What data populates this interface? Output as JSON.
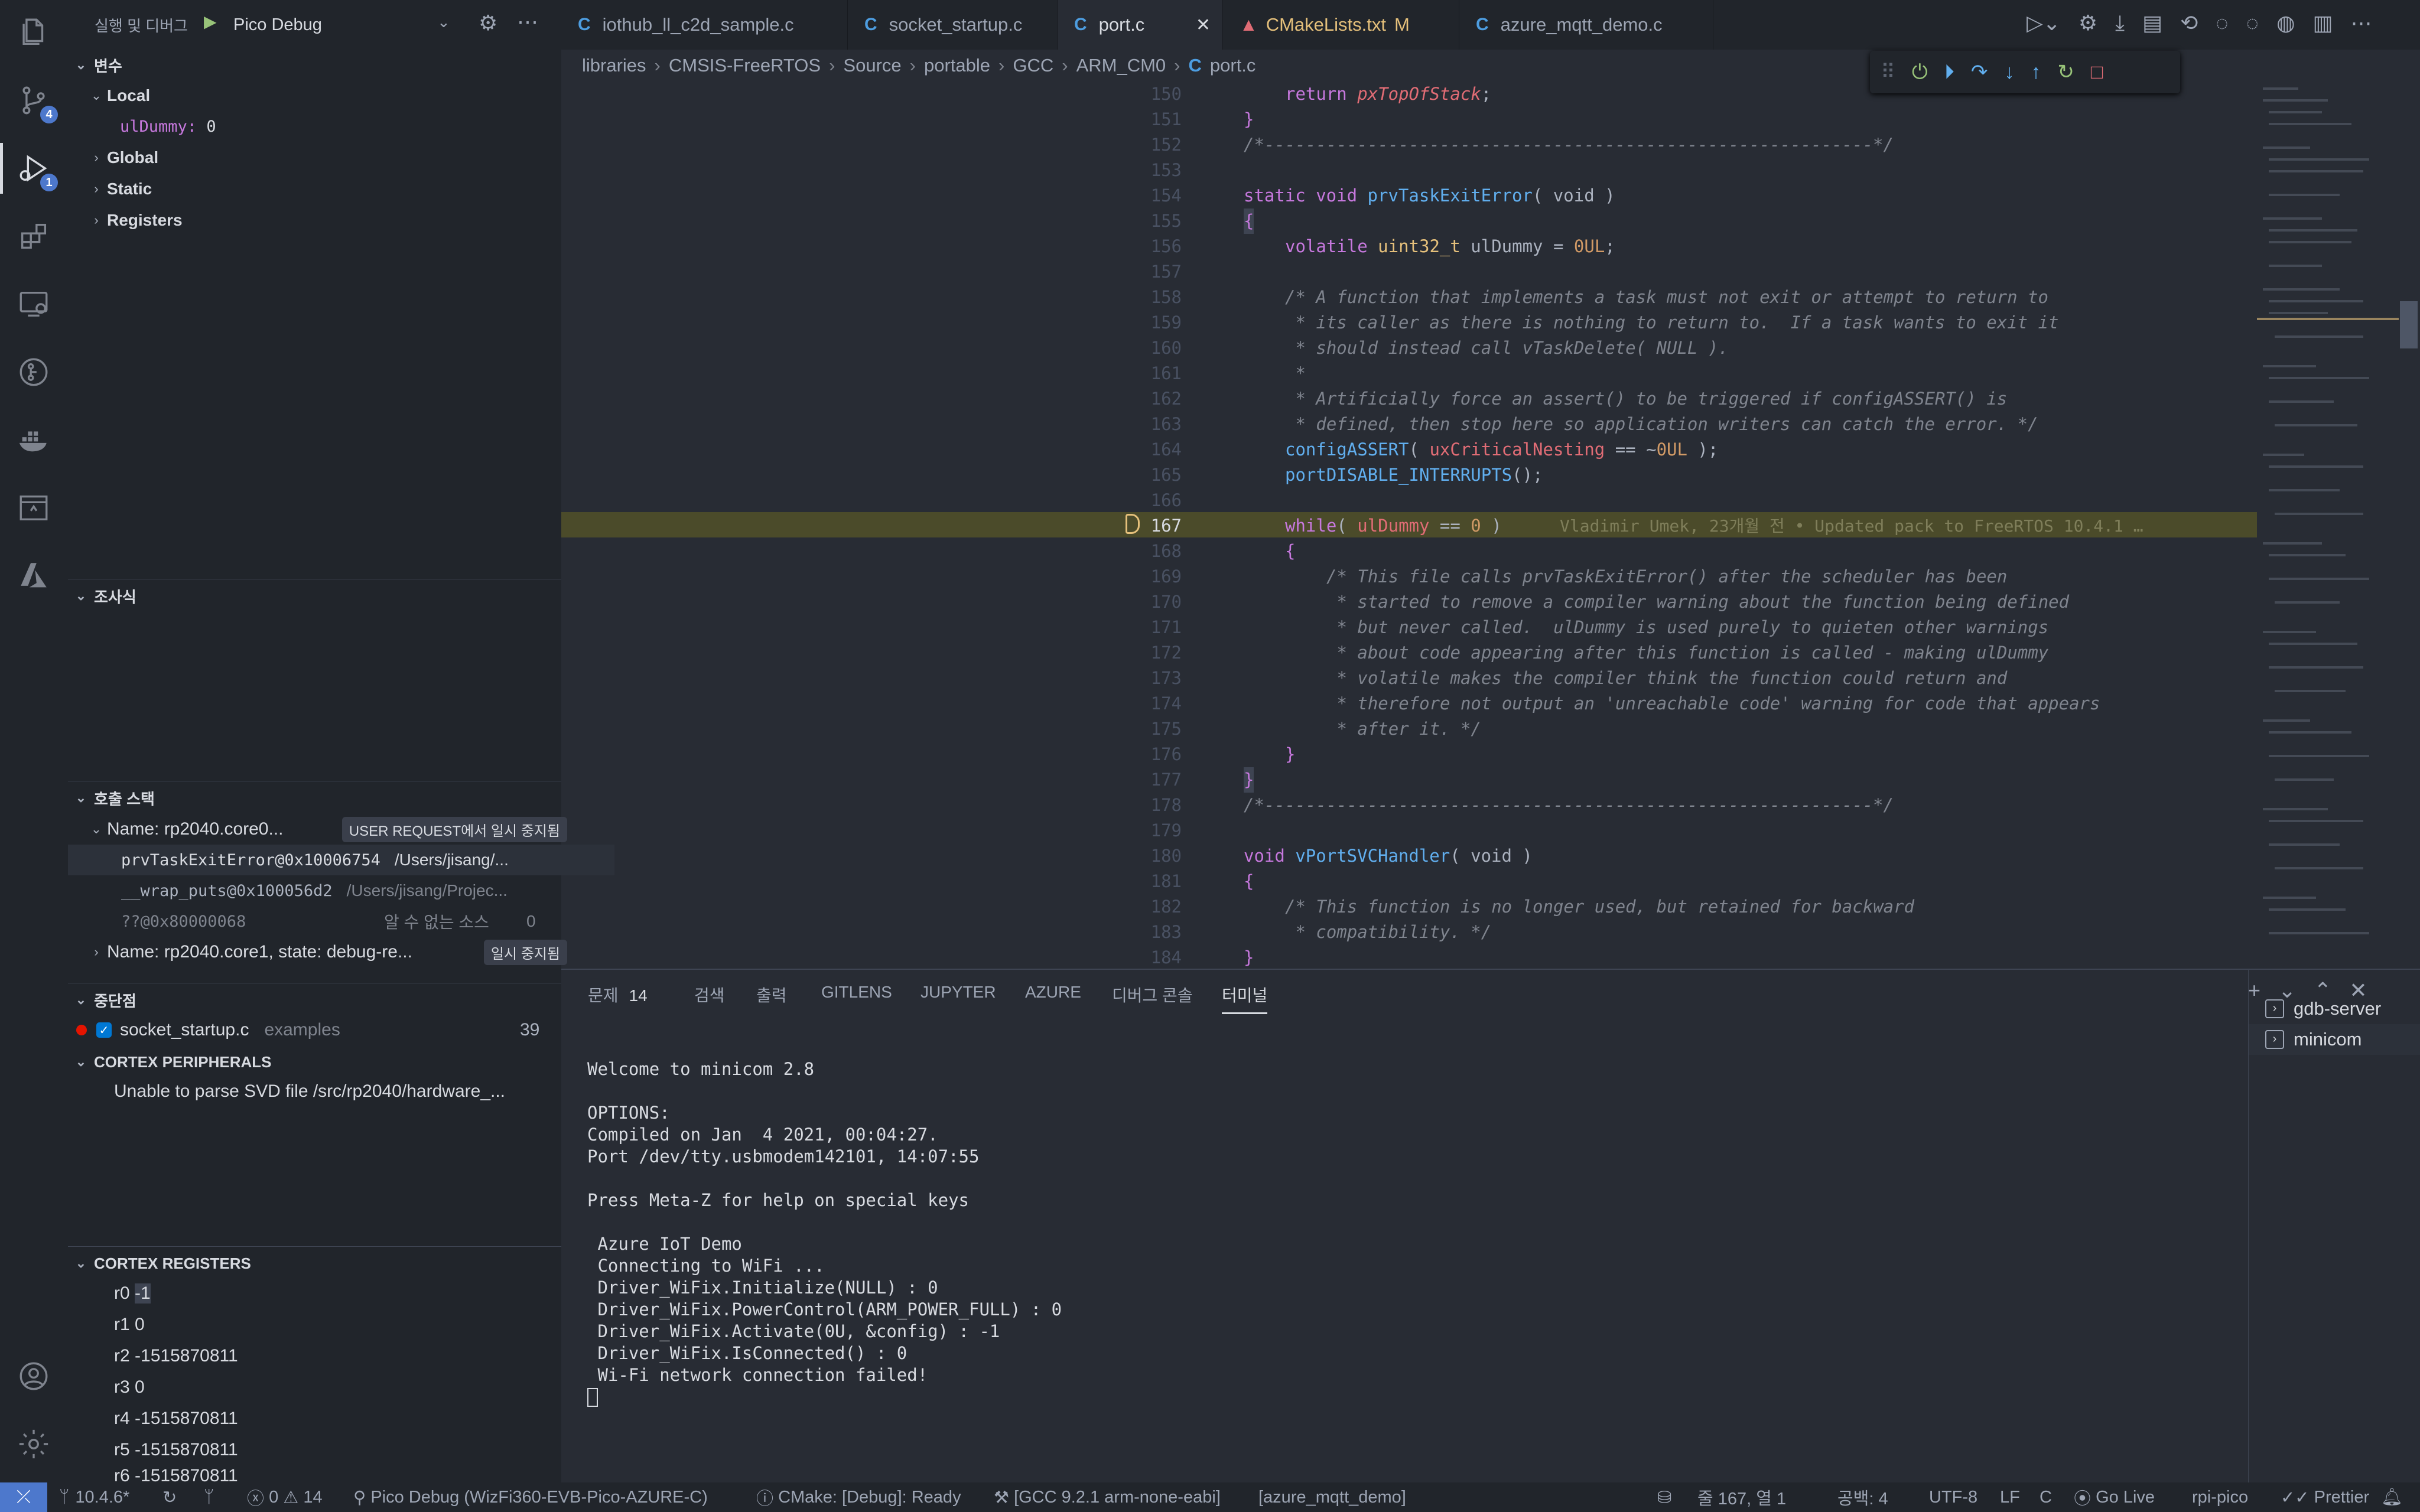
{
  "sidebar": {
    "debug_title": "실행 및 디버그",
    "config": "Pico Debug",
    "variables_header": "변수",
    "variables": {
      "local": "Local",
      "local_var_name": "ulDummy",
      "local_var_value": "0",
      "global": "Global",
      "static": "Static",
      "registers": "Registers"
    },
    "watch_header": "조사식",
    "callstack_header": "호출 스택",
    "callstack": {
      "thread0": "Name: rp2040.core0...",
      "thread0_state": "USER REQUEST에서 일시 중지됨",
      "frame0_fn": "prvTaskExitError@0x10006754",
      "frame0_path": "/Users/jisang/...",
      "frame1_fn": "__wrap_puts@0x100056d2",
      "frame1_path": "/Users/jisang/Projec...",
      "frame2_fn": "??@0x80000068",
      "frame2_src": "알 수 없는 소스",
      "frame2_line": "0",
      "thread1": "Name: rp2040.core1, state: debug-re...",
      "thread1_state": "일시 중지됨"
    },
    "breakpoints_header": "중단점",
    "breakpoint": {
      "file": "socket_startup.c",
      "folder": "examples",
      "line": "39"
    },
    "peripherals_header": "CORTEX PERIPHERALS",
    "peripherals_msg": "Unable to parse SVD file /src/rp2040/hardware_...",
    "registers_header": "CORTEX REGISTERS",
    "registers": [
      {
        "name": "r0",
        "value": "-1"
      },
      {
        "name": "r1",
        "value": "0"
      },
      {
        "name": "r2",
        "value": "-1515870811"
      },
      {
        "name": "r3",
        "value": "0"
      },
      {
        "name": "r4",
        "value": "-1515870811"
      },
      {
        "name": "r5",
        "value": "-1515870811"
      },
      {
        "name": "r6",
        "value": "-1515870811"
      }
    ]
  },
  "activity": {
    "scm_badge": "4",
    "debug_badge": "1"
  },
  "tabs": [
    {
      "label": "iothub_ll_c2d_sample.c",
      "icon": "C"
    },
    {
      "label": "socket_startup.c",
      "icon": "C"
    },
    {
      "label": "port.c",
      "icon": "C"
    },
    {
      "label": "CMakeLists.txt",
      "icon": "cmake",
      "modified": "M"
    },
    {
      "label": "azure_mqtt_demo.c",
      "icon": "C"
    }
  ],
  "breadcrumb": [
    "libraries",
    "CMSIS-FreeRTOS",
    "Source",
    "portable",
    "GCC",
    "ARM_CM0",
    "port.c"
  ],
  "editor": {
    "blame": "Vladimir Umek, 23개월 전 • Updated pack to FreeRTOS 10.4.1 …",
    "current_line": "167",
    "line_numbers": [
      "150",
      "151",
      "152",
      "153",
      "154",
      "155",
      "156",
      "157",
      "158",
      "159",
      "160",
      "161",
      "162",
      "163",
      "164",
      "165",
      "166",
      "167",
      "168",
      "169",
      "170",
      "171",
      "172",
      "173",
      "174",
      "175",
      "176",
      "177",
      "178",
      "179",
      "180",
      "181",
      "182",
      "183",
      "184"
    ],
    "code": {
      "150_kw": "return",
      "150_v": "pxTopOfStack",
      "151": "}",
      "152": "/*-----------------------------------------------------------*/",
      "154_kw": "static void",
      "154_fn": "prvTaskExitError",
      "154_rest": "( void )",
      "155": "{",
      "156_kw": "volatile",
      "156_ty": "uint32_t",
      "156_rest": " ulDummy = ",
      "156_num": "0UL",
      "156_end": ";",
      "158": "/* A function that implements a task must not exit or attempt to return to",
      "159": " * its caller as there is nothing to return to.  If a task wants to exit it",
      "160": " * should instead call vTaskDelete( NULL ).",
      "161": " *",
      "162": " * Artificially force an assert() to be triggered if configASSERT() is",
      "163": " * defined, then stop here so application writers can catch the error. */",
      "164_fn": "configASSERT",
      "164_a": "( ",
      "164_v": "uxCriticalNesting",
      "164_b": " == ~",
      "164_num": "0UL",
      "164_c": " );",
      "165_fn": "portDISABLE_INTERRUPTS",
      "165_rest": "();",
      "167_kw": "while",
      "167_a": "( ",
      "167_v": "ulDummy",
      "167_b": " == ",
      "167_num": "0",
      "167_c": " )",
      "168": "{",
      "169": "/* This file calls prvTaskExitError() after the scheduler has been",
      "170": " * started to remove a compiler warning about the function being defined",
      "171": " * but never called.  ulDummy is used purely to quieten other warnings",
      "172": " * about code appearing after this function is called - making ulDummy",
      "173": " * volatile makes the compiler think the function could return and",
      "174": " * therefore not output an 'unreachable code' warning for code that appears",
      "175": " * after it. */",
      "176": "}",
      "177": "}",
      "178": "/*-----------------------------------------------------------*/",
      "180_kw": "void",
      "180_fn": "vPortSVCHandler",
      "180_rest": "( void )",
      "181": "{",
      "182": "/* This function is no longer used, but retained for backward",
      "183": " * compatibility. */",
      "184": "}"
    }
  },
  "panel": {
    "tabs": [
      "문제",
      "검색",
      "출력",
      "GITLENS",
      "JUPYTER",
      "AZURE",
      "디버그 콘솔",
      "터미널"
    ],
    "problems_count": "14",
    "terminal_lines": "Welcome to minicom 2.8\n\nOPTIONS:\nCompiled on Jan  4 2021, 00:04:27.\nPort /dev/tty.usbmodem142101, 14:07:55\n\nPress Meta-Z for help on special keys\n\n Azure IoT Demo\n Connecting to WiFi ...\n Driver_WiFix.Initialize(NULL) : 0\n Driver_WiFix.PowerControl(ARM_POWER_FULL) : 0\n Driver_WiFix.Activate(0U, &config) : -1\n Driver_WiFix.IsConnected() : 0\n Wi-Fi network connection failed!",
    "terminals": [
      "gdb-server",
      "minicom"
    ]
  },
  "status": {
    "branch": "10.4.6*",
    "errors": "0",
    "warnings": "14",
    "debug": "Pico Debug (WizFi360-EVB-Pico-AZURE-C)",
    "cmake": "CMake: [Debug]: Ready",
    "kit": "[GCC 9.2.1 arm-none-eabi]",
    "target": "[azure_mqtt_demo]",
    "position": "줄 167, 열 1",
    "spaces": "공백: 4",
    "encoding": "UTF-8",
    "eol": "LF",
    "language": "C",
    "golive": "Go Live",
    "board": "rpi-pico",
    "prettier": "Prettier"
  },
  "colors": {
    "accent": "#4d78cc",
    "debug_line": "#4b4b2a",
    "breakpoint": "#e51400",
    "paused": "#e5c07b"
  }
}
